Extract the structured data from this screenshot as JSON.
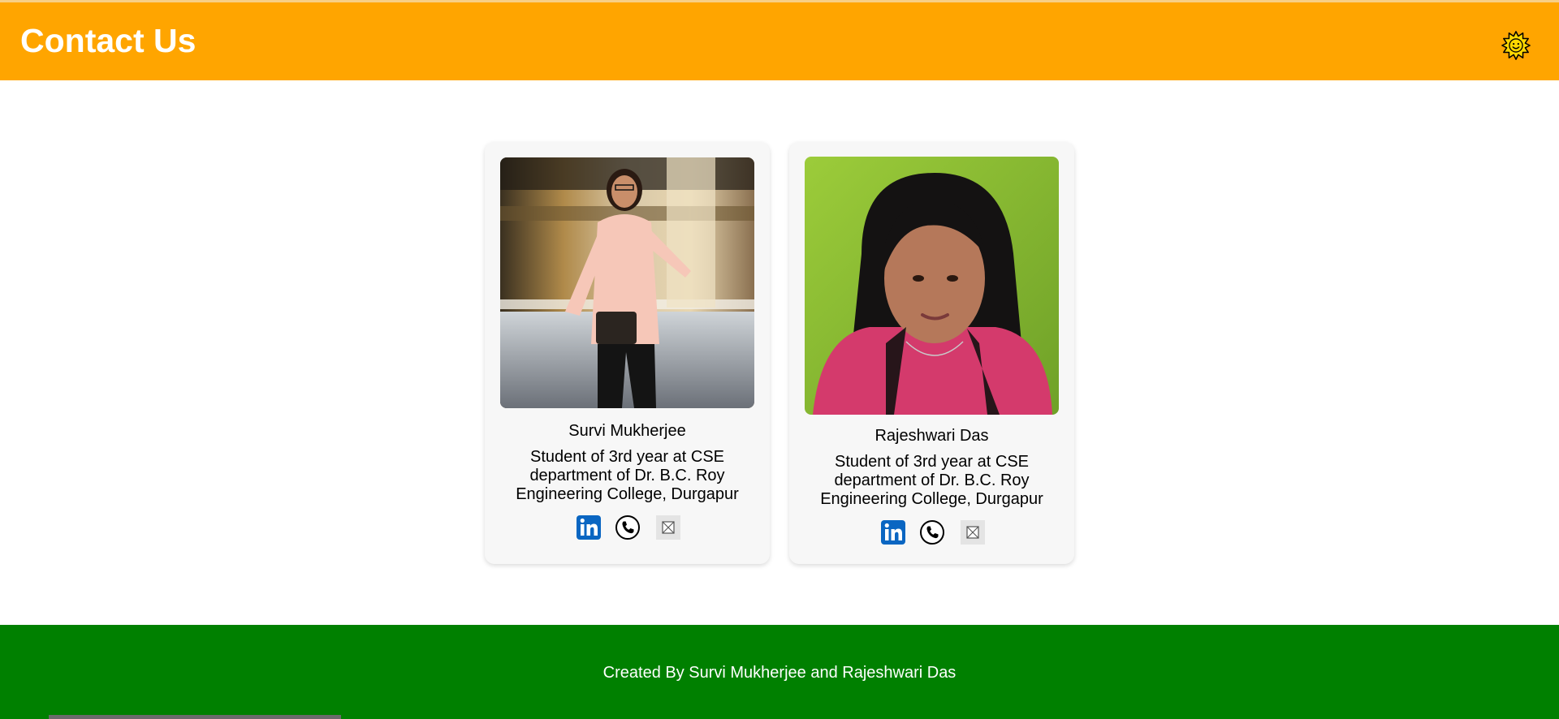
{
  "header": {
    "title": "Contact Us",
    "theme_toggle_icon": "sun-face-icon",
    "background_color": "#ffa500"
  },
  "contacts": [
    {
      "name": "Survi Mukherjee",
      "description": "Student of 3rd year at CSE department of Dr. B.C. Roy Engineering College, Durgapur",
      "photo_icon": "profile-photo",
      "links": [
        "linkedin-icon",
        "phone-icon",
        "email-icon"
      ]
    },
    {
      "name": "Rajeshwari Das",
      "description": "Student of 3rd year at CSE department of Dr. B.C. Roy Engineering College, Durgapur",
      "photo_icon": "profile-photo",
      "links": [
        "linkedin-icon",
        "phone-icon",
        "email-icon"
      ]
    }
  ],
  "footer": {
    "text": "Created By Survi Mukherjee and Rajeshwari Das",
    "background_color": "#008000"
  },
  "colors": {
    "accent": "#ffa500",
    "footer": "#008000",
    "linkedin": "#0a66c2"
  }
}
